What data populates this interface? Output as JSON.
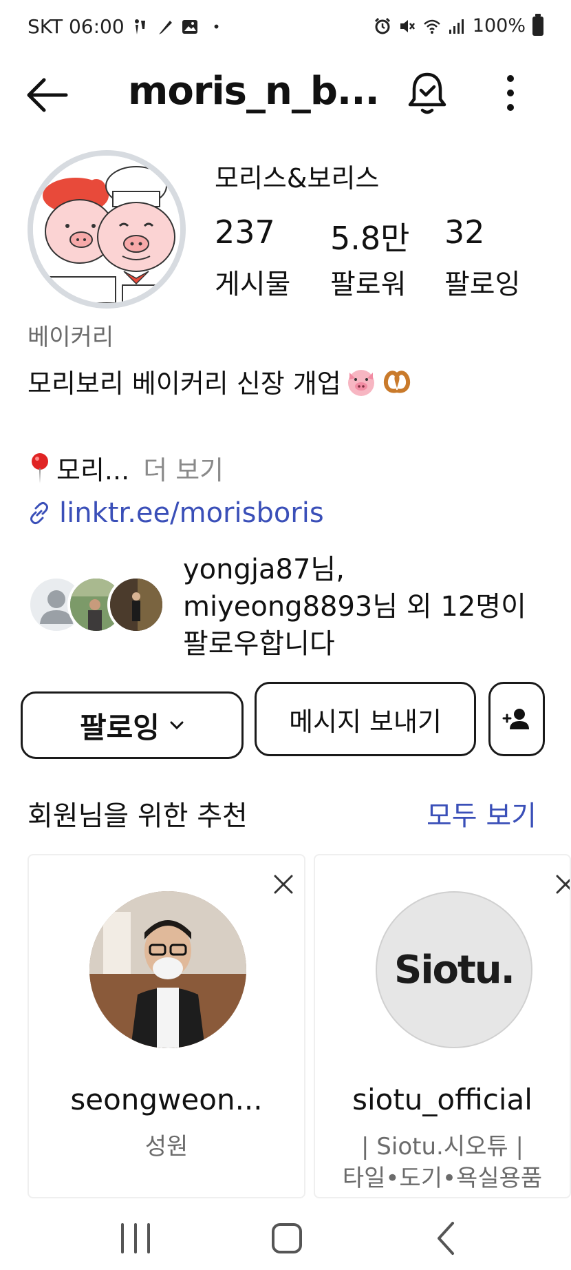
{
  "status_bar": {
    "carrier_time": "SKT 06:00",
    "dot": "•",
    "battery": "100%",
    "left_icons": [
      "walk-icon",
      "feather-icon",
      "image-icon"
    ],
    "right_icons": [
      "alarm-icon",
      "mute-icon",
      "wifi-icon",
      "signal-icon",
      "battery-icon"
    ]
  },
  "header": {
    "username": "moris_n_b...",
    "icons": [
      "back-arrow-icon",
      "bell-check-icon",
      "more-vertical-icon"
    ]
  },
  "profile": {
    "name": "모리스&보리스",
    "stats": [
      {
        "value": "237",
        "label": "게시물"
      },
      {
        "value": "5.8만",
        "label": "팔로워"
      },
      {
        "value": "32",
        "label": "팔로잉"
      }
    ],
    "category": "베이커리",
    "bio": "모리보리 베이커리 신장 개업",
    "location_text": "모리...",
    "more_label": "더 보기",
    "link": "linktr.ee/morisboris",
    "followed_by": [
      "yongja87님,",
      "miyeong8893님 외 12명이",
      "팔로우합니다"
    ]
  },
  "actions": {
    "following_label": "팔로잉",
    "message_label": "메시지 보내기"
  },
  "suggestions": {
    "title": "회원님을 위한 추천",
    "see_all": "모두 보기",
    "cards": [
      {
        "username": "seongweon...",
        "subtitle": "성원"
      },
      {
        "username": "siotu_official",
        "subtitle_line1": "| Siotu.시오튜 |",
        "subtitle_line2": "타일•도기•욕실용품",
        "logo_text": "Siotu."
      }
    ]
  },
  "colors": {
    "link": "#3a4fb8",
    "secondary_text": "#6b6b6b",
    "avatar_ring": "#d7dbe0"
  }
}
